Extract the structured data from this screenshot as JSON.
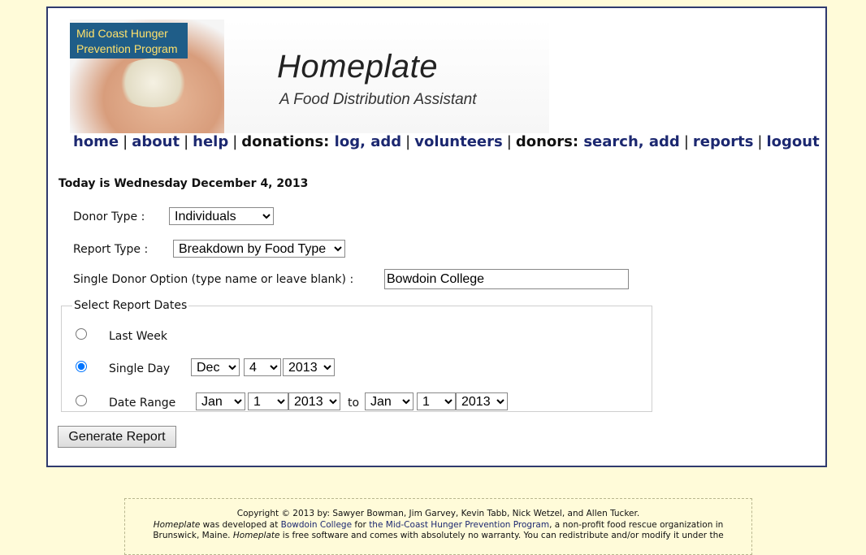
{
  "banner": {
    "logo_line1": "Mid Coast Hunger",
    "logo_line2": "Prevention Program",
    "title": "Homeplate",
    "subtitle": "A Food Distribution Assistant"
  },
  "nav": {
    "home": "home",
    "about": "about",
    "help": "help",
    "donations_label": "donations:",
    "log": "log,",
    "add": "add",
    "volunteers": "volunteers",
    "donors_label": "donors:",
    "search": "search,",
    "add2": "add",
    "reports": "reports",
    "logout": "logout",
    "sep": "|"
  },
  "today": "Today is Wednesday December 4, 2013",
  "form": {
    "donor_type_label": "Donor Type :",
    "donor_type_value": "Individuals",
    "report_type_label": "Report Type :",
    "report_type_value": "Breakdown by Food Type",
    "single_donor_label": "Single Donor Option (type name or leave blank) :",
    "single_donor_value": "Bowdoin College",
    "dates_legend": "Select Report Dates",
    "last_week_label": "Last Week",
    "single_day_label": "Single Day",
    "date_range_label": "Date Range",
    "single_day": {
      "month": "Dec",
      "day": "4",
      "year": "2013"
    },
    "range_from": {
      "month": "Jan",
      "day": "1",
      "year": "2013"
    },
    "to_label": "to",
    "range_to": {
      "month": "Jan",
      "day": "1",
      "year": "2013"
    },
    "selected_option": "Single Day",
    "generate_button": "Generate Report"
  },
  "footer": {
    "copyright": "Copyright © 2013 by: Sawyer Bowman, Jim Garvey, Kevin Tabb, Nick Wetzel, and Allen Tucker.",
    "line2_italic": "Homeplate",
    "line2_a": " was developed at ",
    "bowdoin_link": "Bowdoin College",
    "line2_b": " for ",
    "mchpp_link": "the Mid-Coast Hunger Prevention Program",
    "line2_c": ", a non-profit food rescue organization in",
    "line3_a": "Brunswick, Maine. ",
    "line3_italic": "Homeplate",
    "line3_b": " is free software and comes with absolutely no warranty. You can redistribute and/or modify it under the"
  },
  "colors": {
    "page_bg": "#fffbd9",
    "frame_border": "#2f3a6e",
    "nav_link": "#1c2870",
    "logo_bg": "#1f5d88",
    "logo_text": "#ffe16b"
  }
}
